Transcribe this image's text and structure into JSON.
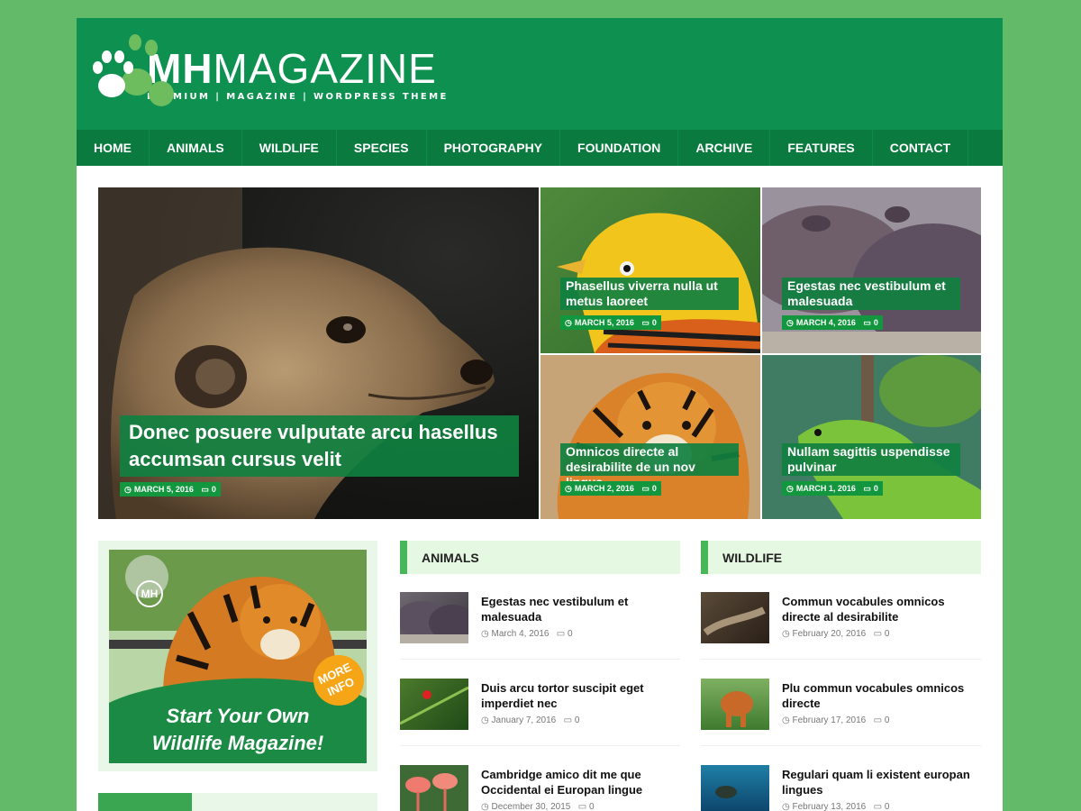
{
  "site": {
    "logo_bold": "MH",
    "logo_light": "MAGAZINE",
    "tagline": "PREMIUM | MAGAZINE | WORDPRESS THEME"
  },
  "nav": [
    "HOME",
    "ANIMALS",
    "WILDLIFE",
    "SPECIES",
    "PHOTOGRAPHY",
    "FOUNDATION",
    "ARCHIVE",
    "FEATURES",
    "CONTACT"
  ],
  "slider": {
    "main": {
      "title": "Donec posuere vulputate arcu hasellus accumsan cursus velit",
      "date": "MARCH 5, 2016",
      "comments": "0"
    },
    "items": [
      {
        "title": "Phasellus viverra nulla ut metus laoreet",
        "date": "MARCH 5, 2016",
        "comments": "0"
      },
      {
        "title": "Egestas nec vestibulum et malesuada",
        "date": "MARCH 4, 2016",
        "comments": "0"
      },
      {
        "title": "Omnicos directe al desirabilite de un nov lingua",
        "date": "MARCH 2, 2016",
        "comments": "0"
      },
      {
        "title": "Nullam sagittis uspendisse pulvinar",
        "date": "MARCH 1, 2016",
        "comments": "0"
      }
    ]
  },
  "ad": {
    "line1": "Start Your Own",
    "line2": "Wildlife Magazine!",
    "badge1": "MORE",
    "badge2": "INFO",
    "logo": "MH"
  },
  "animals": {
    "heading": "ANIMALS",
    "posts": [
      {
        "title": "Egestas nec vestibulum et malesuada",
        "date": "March 4, 2016",
        "comments": "0"
      },
      {
        "title": "Duis arcu tortor suscipit eget imperdiet nec",
        "date": "January 7, 2016",
        "comments": "0"
      },
      {
        "title": "Cambridge amico dit me que Occidental ei Europan lingue",
        "date": "December 30, 2015",
        "comments": "0"
      }
    ]
  },
  "wildlife": {
    "heading": "WILDLIFE",
    "posts": [
      {
        "title": "Commun vocabules omnicos directe al desirabilite",
        "date": "February 20, 2016",
        "comments": "0"
      },
      {
        "title": "Plu commun vocabules omnicos directe",
        "date": "February 17, 2016",
        "comments": "0"
      },
      {
        "title": "Regulari quam li existent europan lingues",
        "date": "February 13, 2016",
        "comments": "0"
      }
    ]
  },
  "icons": {
    "clock": "clock-icon",
    "comment": "comment-icon",
    "paw": "paw-icon"
  },
  "colors": {
    "brand": "#0e9150",
    "nav": "#0a7a3f",
    "accent": "#47b75a",
    "background": "#63bb6a"
  }
}
